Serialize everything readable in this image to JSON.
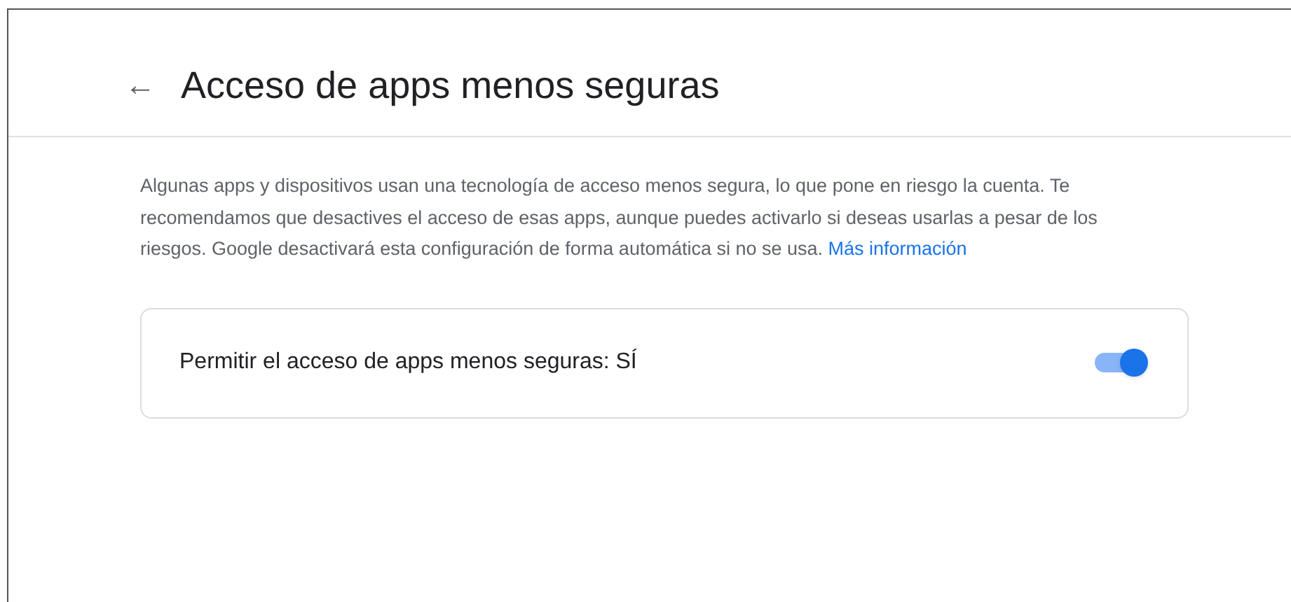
{
  "header": {
    "back_icon": "←",
    "title": "Acceso de apps menos seguras"
  },
  "description": {
    "text": "Algunas apps y dispositivos usan una tecnología de acceso menos segura, lo que pone en riesgo la cuenta. Te recomendamos que desactives el acceso de esas apps, aunque puedes activarlo si deseas usarlas a pesar de los riesgos. Google desactivará esta configuración de forma automática si no se usa.",
    "link": "Más información"
  },
  "setting": {
    "label": "Permitir el acceso de apps menos seguras: SÍ",
    "on": true
  }
}
